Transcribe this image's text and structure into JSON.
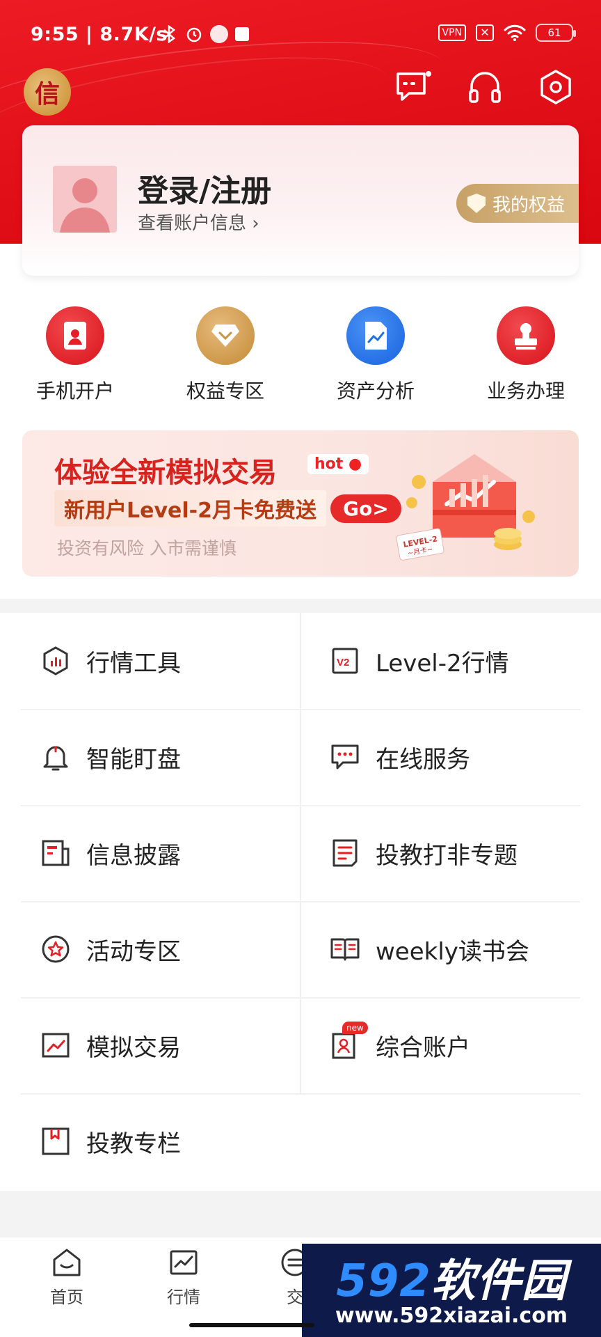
{
  "status_bar": {
    "time": "9:55 | 8.7K/s",
    "vpn": "VPN",
    "battery": "61"
  },
  "header": {
    "logo_char": "信",
    "icons": [
      "message-icon",
      "headset-icon",
      "settings-icon"
    ]
  },
  "user_card": {
    "title": "登录/注册",
    "subtitle": "查看账户信息",
    "rights_badge": "我的权益"
  },
  "quick_menu": [
    {
      "label": "手机开户",
      "icon": "id-card-icon",
      "color": "#e41f25"
    },
    {
      "label": "权益专区",
      "icon": "diamond-icon",
      "color": "#c99341"
    },
    {
      "label": "资产分析",
      "icon": "chart-doc-icon",
      "color": "#1d6fe8"
    },
    {
      "label": "业务办理",
      "icon": "stamp-icon",
      "color": "#e41f25"
    }
  ],
  "banner": {
    "title": "体验全新模拟交易",
    "hot": "hot",
    "subtitle": "新用户Level-2月卡免费送",
    "go": "Go>",
    "risk": "投资有风险  入市需谨慎",
    "card_text": "LEVEL-2 ~月卡~"
  },
  "services": [
    {
      "label": "行情工具",
      "icon": "market-tools-icon"
    },
    {
      "label": "Level-2行情",
      "icon": "level2-icon"
    },
    {
      "label": "智能盯盘",
      "icon": "bell-icon"
    },
    {
      "label": "在线服务",
      "icon": "chat-icon"
    },
    {
      "label": "信息披露",
      "icon": "news-icon"
    },
    {
      "label": "投教打非专题",
      "icon": "document-icon"
    },
    {
      "label": "活动专区",
      "icon": "star-icon"
    },
    {
      "label": "weekly读书会",
      "icon": "book-icon"
    },
    {
      "label": "模拟交易",
      "icon": "trend-icon"
    },
    {
      "label": "综合账户",
      "icon": "account-icon",
      "tag": "new"
    },
    {
      "label": "投教专栏",
      "icon": "bookmark-icon"
    }
  ],
  "bottom_nav": [
    {
      "label": "首页",
      "icon": "home-icon"
    },
    {
      "label": "行情",
      "icon": "chart-icon"
    },
    {
      "label": "交",
      "icon": "trade-icon"
    }
  ],
  "watermark": {
    "num": "592",
    "text": "软件园",
    "url": "www.592xiazai.com"
  },
  "colors": {
    "brand_red": "#e41f25",
    "gold": "#c7a166"
  }
}
